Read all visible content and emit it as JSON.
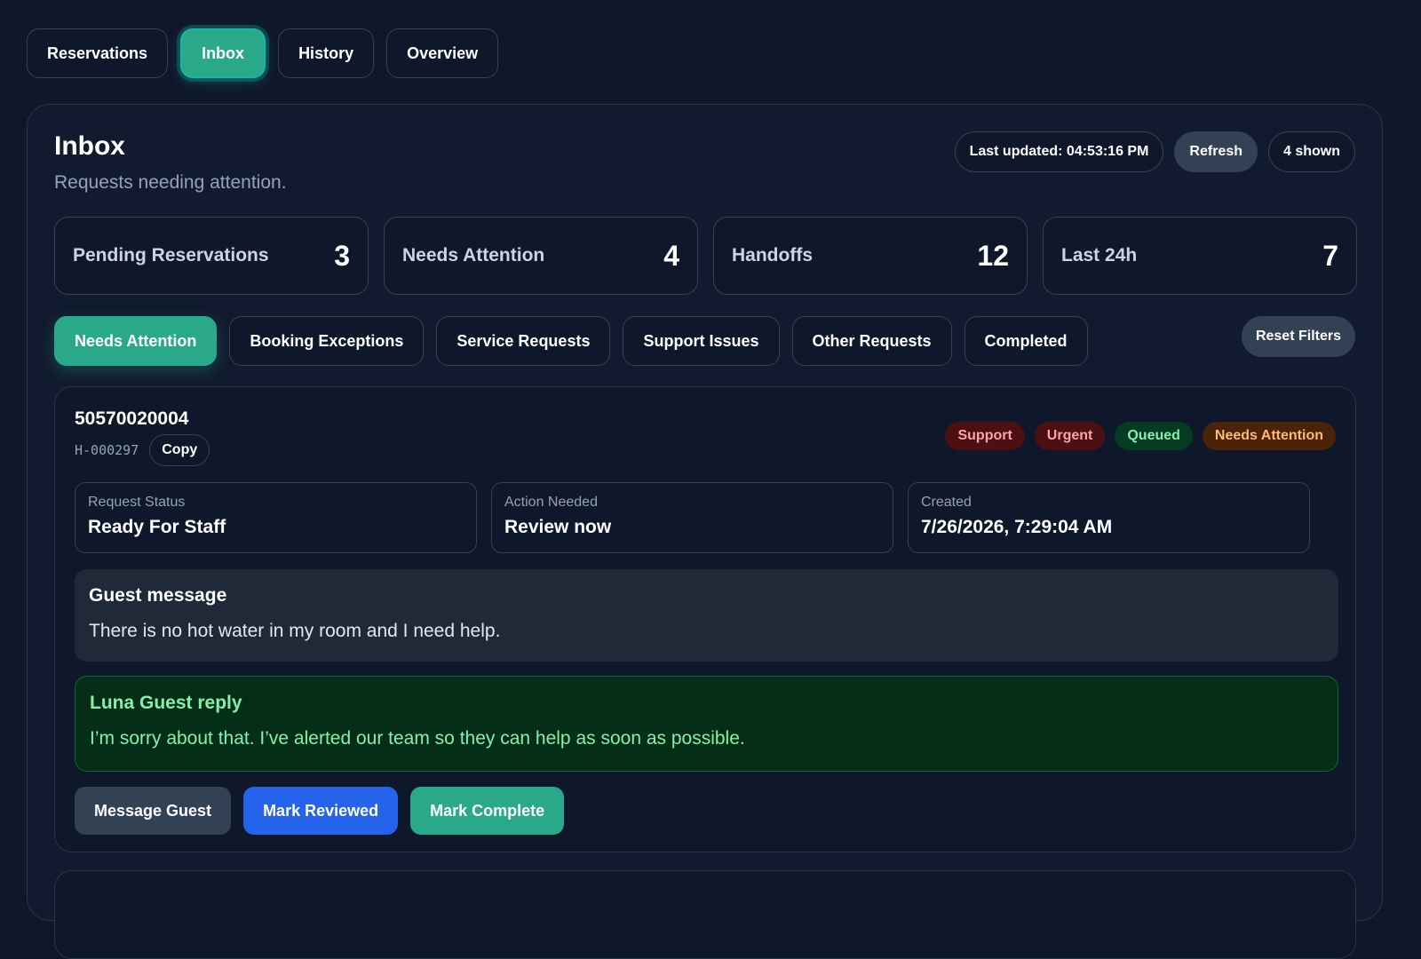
{
  "nav": {
    "tabs": [
      {
        "label": "Reservations"
      },
      {
        "label": "Inbox"
      },
      {
        "label": "History"
      },
      {
        "label": "Overview"
      }
    ],
    "active_index": 1
  },
  "header": {
    "title": "Inbox",
    "subtitle": "Requests needing attention.",
    "last_updated": "Last updated: 04:53:16 PM",
    "refresh_label": "Refresh",
    "shown_count": "4 shown"
  },
  "stats": [
    {
      "label": "Pending Reservations",
      "value": "3"
    },
    {
      "label": "Needs Attention",
      "value": "4"
    },
    {
      "label": "Handoffs",
      "value": "12"
    },
    {
      "label": "Last 24h",
      "value": "7"
    }
  ],
  "filters": {
    "items": [
      {
        "label": "Needs Attention"
      },
      {
        "label": "Booking Exceptions"
      },
      {
        "label": "Service Requests"
      },
      {
        "label": "Support Issues"
      },
      {
        "label": "Other Requests"
      },
      {
        "label": "Completed"
      }
    ],
    "active_index": 0,
    "reset_label": "Reset Filters"
  },
  "request": {
    "id": "50570020004",
    "handoff_code": "H-000297",
    "copy_label": "Copy",
    "tags": [
      {
        "label": "Support",
        "kind": "support"
      },
      {
        "label": "Urgent",
        "kind": "urgent"
      },
      {
        "label": "Queued",
        "kind": "queued"
      },
      {
        "label": "Needs Attention",
        "kind": "needs"
      }
    ],
    "status_label": "Request Status",
    "status_value": "Ready For Staff",
    "action_label": "Action Needed",
    "action_value": "Review now",
    "created_label": "Created",
    "created_value": "7/26/2026, 7:29:04 AM",
    "guest_message_title": "Guest message",
    "guest_message_text": "There is no hot water in my room and I need help.",
    "reply_title": "Luna Guest reply",
    "reply_text": "I’m sorry about that. I’ve alerted our team so they can help as soon as possible.",
    "actions": {
      "message": "Message Guest",
      "reviewed": "Mark Reviewed",
      "complete": "Mark Complete"
    }
  },
  "colors": {
    "background": "#0f172a",
    "accent": "#2aa88a",
    "primary_blue": "#2563eb"
  }
}
